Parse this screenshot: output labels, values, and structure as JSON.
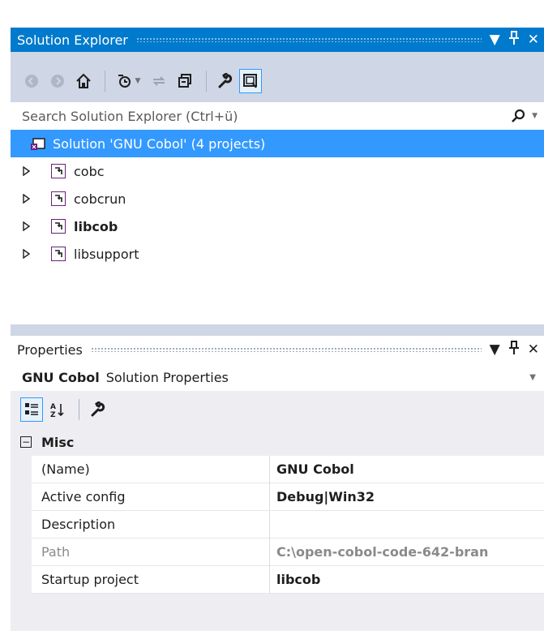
{
  "solution_explorer": {
    "title": "Solution Explorer",
    "search_placeholder": "Search Solution Explorer (Ctrl+ü)",
    "tree": {
      "root": "Solution 'GNU Cobol' (4 projects)",
      "projects": [
        {
          "name": "cobc",
          "bold": false
        },
        {
          "name": "cobcrun",
          "bold": false
        },
        {
          "name": "libcob",
          "bold": true
        },
        {
          "name": "libsupport",
          "bold": false
        }
      ]
    }
  },
  "properties": {
    "title": "Properties",
    "object": {
      "name": "GNU Cobol",
      "type": "Solution Properties"
    },
    "category": "Misc",
    "rows": [
      {
        "name": "(Name)",
        "value": "GNU Cobol"
      },
      {
        "name": "Active config",
        "value": "Debug|Win32"
      },
      {
        "name": "Description",
        "value": ""
      },
      {
        "name": "Path",
        "value": "C:\\open-cobol-code-642-bran"
      },
      {
        "name": "Startup project",
        "value": "libcob"
      }
    ]
  },
  "colors": {
    "accent": "#007acc",
    "selection": "#3399ff",
    "chrome": "#cfd6e5",
    "project_icon": "#68217a"
  }
}
